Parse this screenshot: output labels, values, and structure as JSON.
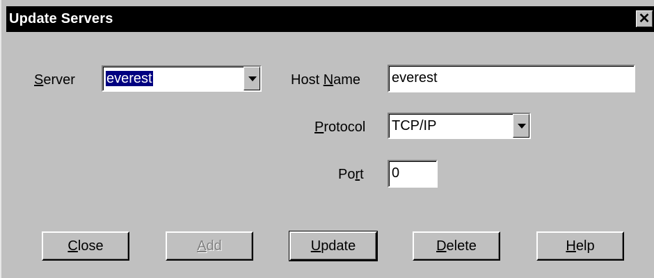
{
  "window": {
    "title": "Update Servers",
    "close_glyph": "✕"
  },
  "form": {
    "server": {
      "label_mn": "S",
      "label_rest": "erver",
      "value": "everest"
    },
    "host_name": {
      "label_pre": "Host ",
      "label_mn": "N",
      "label_rest": "ame",
      "value": "everest"
    },
    "protocol": {
      "label_mn": "P",
      "label_rest": "rotocol",
      "value": "TCP/IP"
    },
    "port": {
      "label_pre": "Po",
      "label_mn": "r",
      "label_rest": "t",
      "value": "0"
    }
  },
  "buttons": {
    "close": {
      "mn": "C",
      "rest": "lose"
    },
    "add": {
      "mn": "A",
      "rest": "dd"
    },
    "update": {
      "mn": "U",
      "rest": "pdate"
    },
    "delete": {
      "mn": "D",
      "rest": "elete"
    },
    "help": {
      "mn": "H",
      "rest": "elp"
    }
  }
}
